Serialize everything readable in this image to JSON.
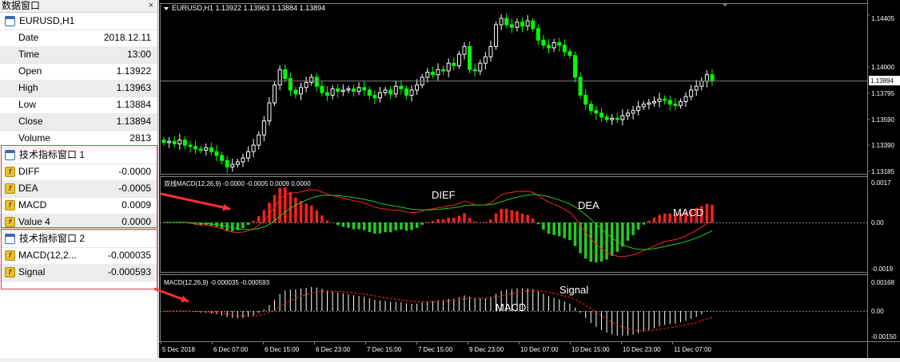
{
  "data_window": {
    "title": "数据窗口",
    "close_glyph": "×",
    "symbol_header": "EURUSD,H1",
    "fields": [
      {
        "label": "Date",
        "value": "2018.12.11"
      },
      {
        "label": "Time",
        "value": "13:00"
      },
      {
        "label": "Open",
        "value": "1.13922"
      },
      {
        "label": "High",
        "value": "1.13963"
      },
      {
        "label": "Low",
        "value": "1.13884"
      },
      {
        "label": "Close",
        "value": "1.13894"
      },
      {
        "label": "Volume",
        "value": "2813"
      }
    ],
    "indicator_window_1": {
      "header": "技术指标窗口 1",
      "fields": [
        {
          "label": "DIFF",
          "value": "-0.0000"
        },
        {
          "label": "DEA",
          "value": "-0.0005"
        },
        {
          "label": "MACD",
          "value": "0.0009"
        },
        {
          "label": "Value 4",
          "value": "0.0000"
        }
      ]
    },
    "indicator_window_2": {
      "header": "技术指标窗口 2",
      "fields": [
        {
          "label": "MACD(12,2...",
          "value": "-0.000035"
        },
        {
          "label": "Signal",
          "value": "-0.000593"
        }
      ]
    }
  },
  "main_chart": {
    "header": "EURUSD,H1  1.13922 1.13963 1.13884 1.13894",
    "price_labels": [
      "1.14405",
      "1.14000",
      "1.13795",
      "1.13590",
      "1.13390",
      "1.13185"
    ],
    "current_price": "1.13894"
  },
  "macd_panel_1": {
    "header": "双线MACD(12,26,9) -0.0000 -0.0005 0.0009 0.0000",
    "labels": [
      "0.0017",
      "0.00",
      "-0.0019"
    ],
    "annotations": [
      "DIEF",
      "DEA",
      "MACD"
    ]
  },
  "macd_panel_2": {
    "header": "MACD(12,26,9) -0.000035 -0.000593",
    "labels": [
      "0.00168",
      "0.00",
      "-0.00150"
    ],
    "annotations": [
      "MACD",
      "Signal"
    ]
  },
  "time_axis": [
    "5 Dec 2018",
    "6 Dec 07:00",
    "6 Dec 15:00",
    "6 Dec 23:00",
    "7 Dec 15:00",
    "7 Dec 15:00",
    "9 Dec 23:00",
    "10 Dec 07:00",
    "10 Dec 15:00",
    "10 Dec 23:00",
    "11 Dec 07:00"
  ],
  "colors": {
    "bull": "#ffffff",
    "bear": "#00ff00",
    "hist_up": "#ff2020",
    "hist_down": "#22cc22",
    "diff_line": "#ff2020",
    "dea_line": "#22cc22",
    "macd_bar": "#ffffff",
    "signal_line": "#ff2020",
    "annotation_arrow": "#ff3030",
    "panel_box": "#e04040"
  },
  "chart_data": {
    "type": "candlestick",
    "close_series": [
      1.1341,
      1.1342,
      1.134,
      1.1343,
      1.1339,
      1.1338,
      1.1336,
      1.1335,
      1.1337,
      1.1334,
      1.1331,
      1.1327,
      1.1322,
      1.1324,
      1.1326,
      1.1329,
      1.1334,
      1.1339,
      1.1347,
      1.1358,
      1.1372,
      1.1386,
      1.1398,
      1.1391,
      1.1382,
      1.1379,
      1.1384,
      1.1388,
      1.1392,
      1.1385,
      1.138,
      1.1378,
      1.1383,
      1.1381,
      1.1382,
      1.1383,
      1.1381,
      1.1384,
      1.1382,
      1.1378,
      1.1376,
      1.138,
      1.1382,
      1.1379,
      1.1385,
      1.1383,
      1.1378,
      1.1382,
      1.1386,
      1.1392,
      1.1396,
      1.1394,
      1.1398,
      1.1397,
      1.1403,
      1.1401,
      1.141,
      1.1416,
      1.1398,
      1.1397,
      1.1403,
      1.1408,
      1.1416,
      1.1433,
      1.1438,
      1.1433,
      1.1431,
      1.1435,
      1.1432,
      1.1436,
      1.143,
      1.1421,
      1.1417,
      1.1415,
      1.1419,
      1.1417,
      1.1412,
      1.1409,
      1.1392,
      1.1378,
      1.1371,
      1.1366,
      1.1364,
      1.1361,
      1.1359,
      1.136,
      1.1359,
      1.1362,
      1.1364,
      1.1366,
      1.1369,
      1.1371,
      1.1372,
      1.1373,
      1.1375,
      1.1374,
      1.1371,
      1.137,
      1.1373,
      1.1377,
      1.1382,
      1.1385,
      1.1389,
      1.1394,
      1.1389
    ]
  }
}
